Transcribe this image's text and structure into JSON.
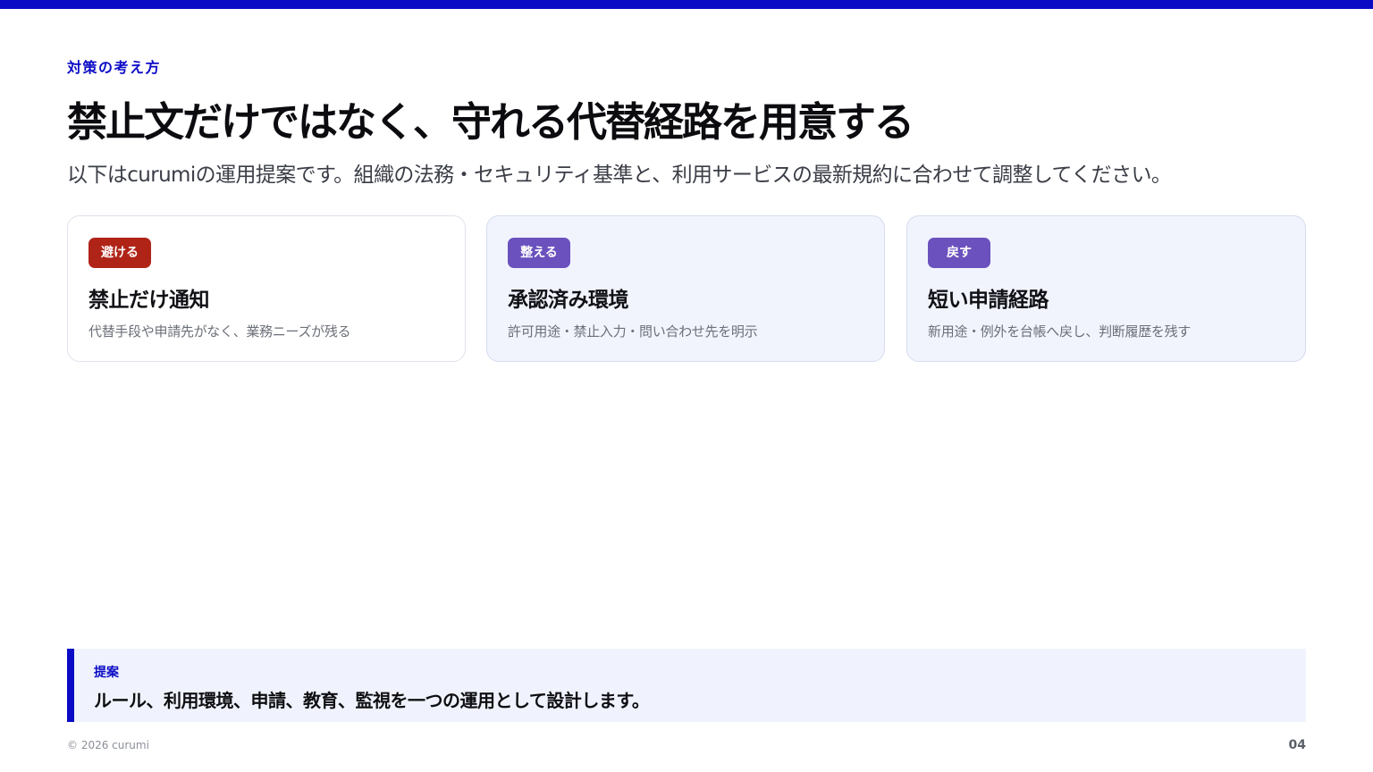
{
  "header": {
    "eyebrow": "対策の考え方",
    "title": "禁止文だけではなく、守れる代替経路を用意する",
    "subtitle": "以下はcurumiの運用提案です。組織の法務・セキュリティ基準と、利用サービスの最新規約に合わせて調整してください。"
  },
  "cards": [
    {
      "badge": "避ける",
      "badge_color": "#b02418",
      "title": "禁止だけ通知",
      "description": "代替手段や申請先がなく、業務ニーズが残る"
    },
    {
      "badge": "整える",
      "badge_color": "#6a51bd",
      "title": "承認済み環境",
      "description": "許可用途・禁止入力・問い合わせ先を明示"
    },
    {
      "badge": "戻す",
      "badge_color": "#6a51bd",
      "title": "短い申請経路",
      "description": "新用途・例外を台帳へ戻し、判断履歴を残す"
    }
  ],
  "proposal": {
    "label": "提案",
    "text": "ルール、利用環境、申請、教育、監視を一つの運用として設計します。"
  },
  "footer": {
    "copyright": "© 2026 curumi",
    "page_number": "04"
  },
  "colors": {
    "accent": "#0b0bc6",
    "warning": "#b02418",
    "positive": "#6a51bd"
  }
}
